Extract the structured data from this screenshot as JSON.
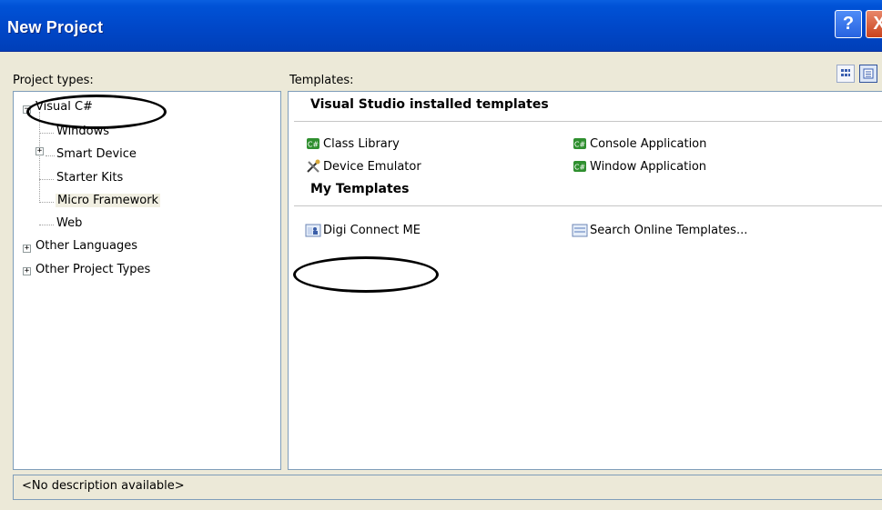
{
  "window": {
    "title": "New Project",
    "help_symbol": "?",
    "close_symbol": "X"
  },
  "labels": {
    "project_types": "Project types:",
    "templates": "Templates:"
  },
  "view_buttons": [
    {
      "name": "large-icons-view",
      "icon": "grid-icon"
    },
    {
      "name": "small-icons-view",
      "icon": "list-icon"
    }
  ],
  "project_types": {
    "visual_csharp": "Visual C#",
    "windows": "Windows",
    "smart_device": "Smart Device",
    "starter_kits": "Starter Kits",
    "micro_framework": "Micro Framework",
    "web": "Web",
    "other_languages": "Other Languages",
    "other_project_types": "Other Project Types",
    "selected": "Micro Framework"
  },
  "templates": {
    "installed_header": "Visual Studio installed templates",
    "installed": {
      "class_library": "Class Library",
      "console_application": "Console Application",
      "device_emulator": "Device Emulator",
      "window_application": "Window Application"
    },
    "my_header": "My Templates",
    "my": {
      "digi_connect_me": "Digi Connect ME",
      "search_online": "Search Online Templates..."
    }
  },
  "description": "<No description available>",
  "colors": {
    "title_bar": "#0047c8",
    "dialog_bg": "#ece9d8",
    "border": "#7f9db9",
    "selection_bg": "#f1efe2"
  },
  "annotations": [
    "visual-csharp-ring",
    "digi-connect-me-ring"
  ]
}
